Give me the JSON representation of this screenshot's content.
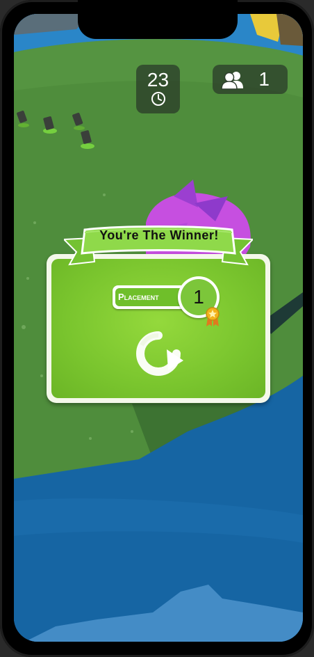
{
  "hud": {
    "timer_value": "23",
    "timer_icon": "clock-icon",
    "players_icon": "players-icon",
    "players_count": "1"
  },
  "result": {
    "banner_text": "You're The Winner!",
    "placement_label": "Placement",
    "placement_value": "1",
    "medal_icon": "medal-icon",
    "replay_icon": "replay-icon"
  },
  "colors": {
    "card_green": "#7ac52e",
    "ribbon_green": "#8fd94a",
    "water_blue": "#1e6fae",
    "grass_green": "#4d8c3b",
    "blob_purple": "#c64fe0"
  }
}
